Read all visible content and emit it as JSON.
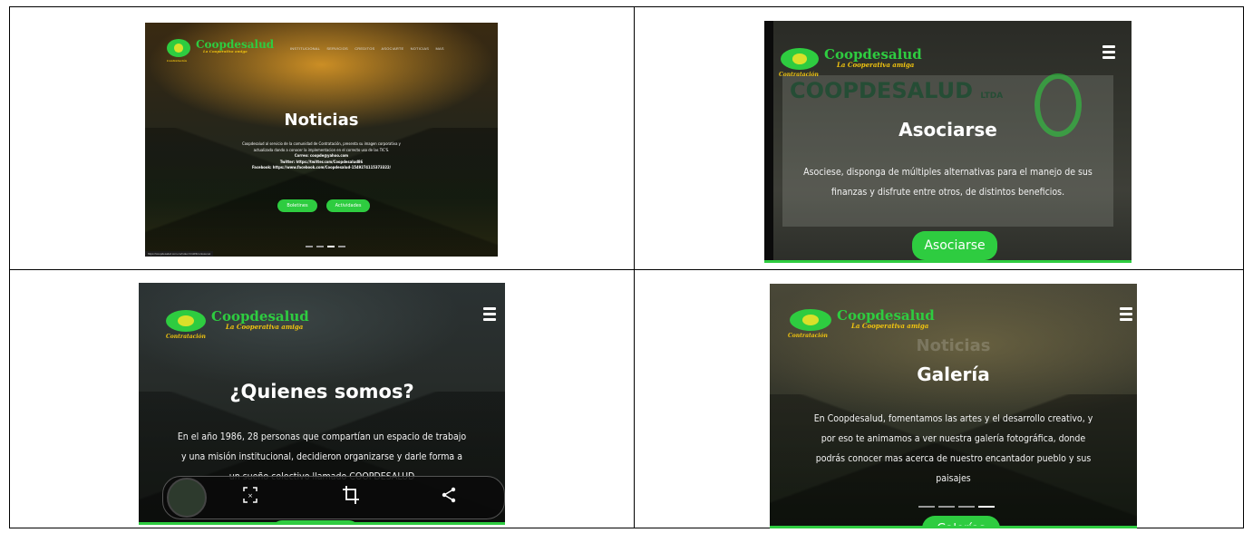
{
  "panels": [
    {
      "logo": {
        "name": "Coopdesalud",
        "tagline": "La Cooperativa amiga",
        "place": "Contratación"
      },
      "nav": [
        "INSTITUCIONAL",
        "SERVICIOS",
        "CREDITOS",
        "ASOCIARTE",
        "NOTICIAS",
        "MAS"
      ],
      "title": "Noticias",
      "lines": [
        "Coopdesalud al servicio de la comunidad de Contratación, presenta su imagen corporativa y",
        "actualizada dando a conocer la implementacion en el correcto uso de las TIC'S.",
        "Correo: coopde@yahoo.com",
        "Twitter: https://twitter.com/Coopdesalud86",
        "Facebook: https://www.facebook.com/Coopdesalud-1549274115373322/"
      ],
      "buttons": [
        "Boletines",
        "Actividades"
      ],
      "status_url": "https://coopdesalud.com.co/index.html#Fcontusunet"
    },
    {
      "logo": {
        "name": "Coopdesalud",
        "tagline": "La Cooperativa amiga",
        "place": "Contratación"
      },
      "sign": "COOPDESALUD",
      "sign_suffix": "LTDA",
      "title": "Asociarse",
      "lines": [
        "Asociese, disponga de múltiples alternativas para el manejo de sus",
        "finanzas y disfrute entre otros, de distintos beneficios."
      ],
      "button": "Asociarse"
    },
    {
      "logo": {
        "name": "Coopdesalud",
        "tagline": "La Cooperativa amiga",
        "place": "Contratación"
      },
      "title": "¿Quienes somos?",
      "lines": [
        "En el año 1986, 28 personas que compartían un espacio de trabajo",
        "y una misión institucional, decidieron organizarse y darle forma a",
        "un sueño colectivo llamado COOPDESALUD"
      ],
      "overlay_icons": [
        "screenshot-select-icon",
        "crop-icon",
        "share-icon"
      ]
    },
    {
      "logo": {
        "name": "Coopdesalud",
        "tagline": "La Cooperativa amiga",
        "place": "Contratación"
      },
      "ghost_title": "Noticias",
      "title": "Galería",
      "lines": [
        "En Coopdesalud, fomentamos las artes y el desarrollo creativo, y",
        "por eso te animamos a ver nuestra galería fotográfica, donde",
        "podrás conocer mas acerca de nuestro encantador pueblo y sus",
        "paisajes"
      ],
      "button": "Galerías"
    }
  ]
}
